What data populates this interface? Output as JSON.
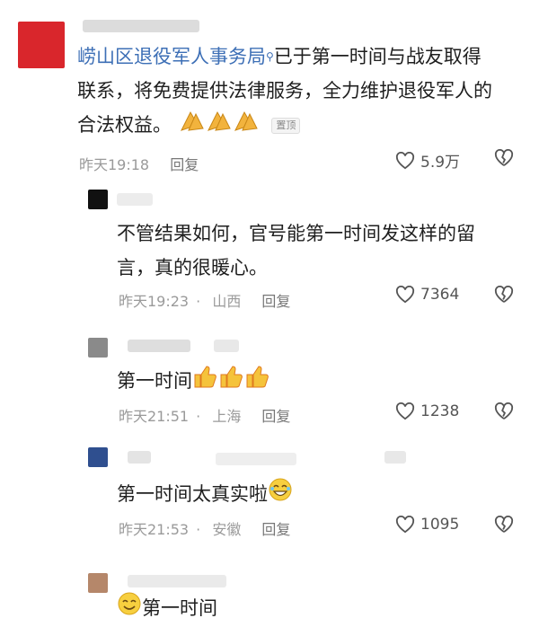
{
  "comments": [
    {
      "author": "崂山区退役军人事务局",
      "verified_icon": "verified-badge-icon",
      "text_line1": "已于第一时间与战友取得",
      "text_line2": "联系，将免费提供法律服务，全力维护退役军人的",
      "text_line3": "合法权益。",
      "emoji": "pray-hands-icon",
      "pin_label": "置顶",
      "time": "昨天19:18",
      "reply": "回复",
      "likes": "5.9万",
      "avatar_color": "#d9262c"
    },
    {
      "text_line1": "不管结果如何，官号能第一时间发这样的留",
      "text_line2": "言，真的很暖心。",
      "time": "昨天19:23",
      "location": "山西",
      "reply": "回复",
      "likes": "7364",
      "avatar_color": "#111111"
    },
    {
      "text_line1": "第一时间",
      "emoji": "thumbs-up-icon",
      "time": "昨天21:51",
      "location": "上海",
      "reply": "回复",
      "likes": "1238",
      "avatar_color": "#8a8a8a"
    },
    {
      "text_line1": "第一时间太真实啦",
      "emoji": "laughing-icon",
      "time": "昨天21:53",
      "location": "安徽",
      "reply": "回复",
      "likes": "1095",
      "avatar_color": "#2f4f8f"
    },
    {
      "text_line1": "第一时间",
      "emoji": "grin-icon",
      "avatar_color": "#b5876a"
    }
  ]
}
